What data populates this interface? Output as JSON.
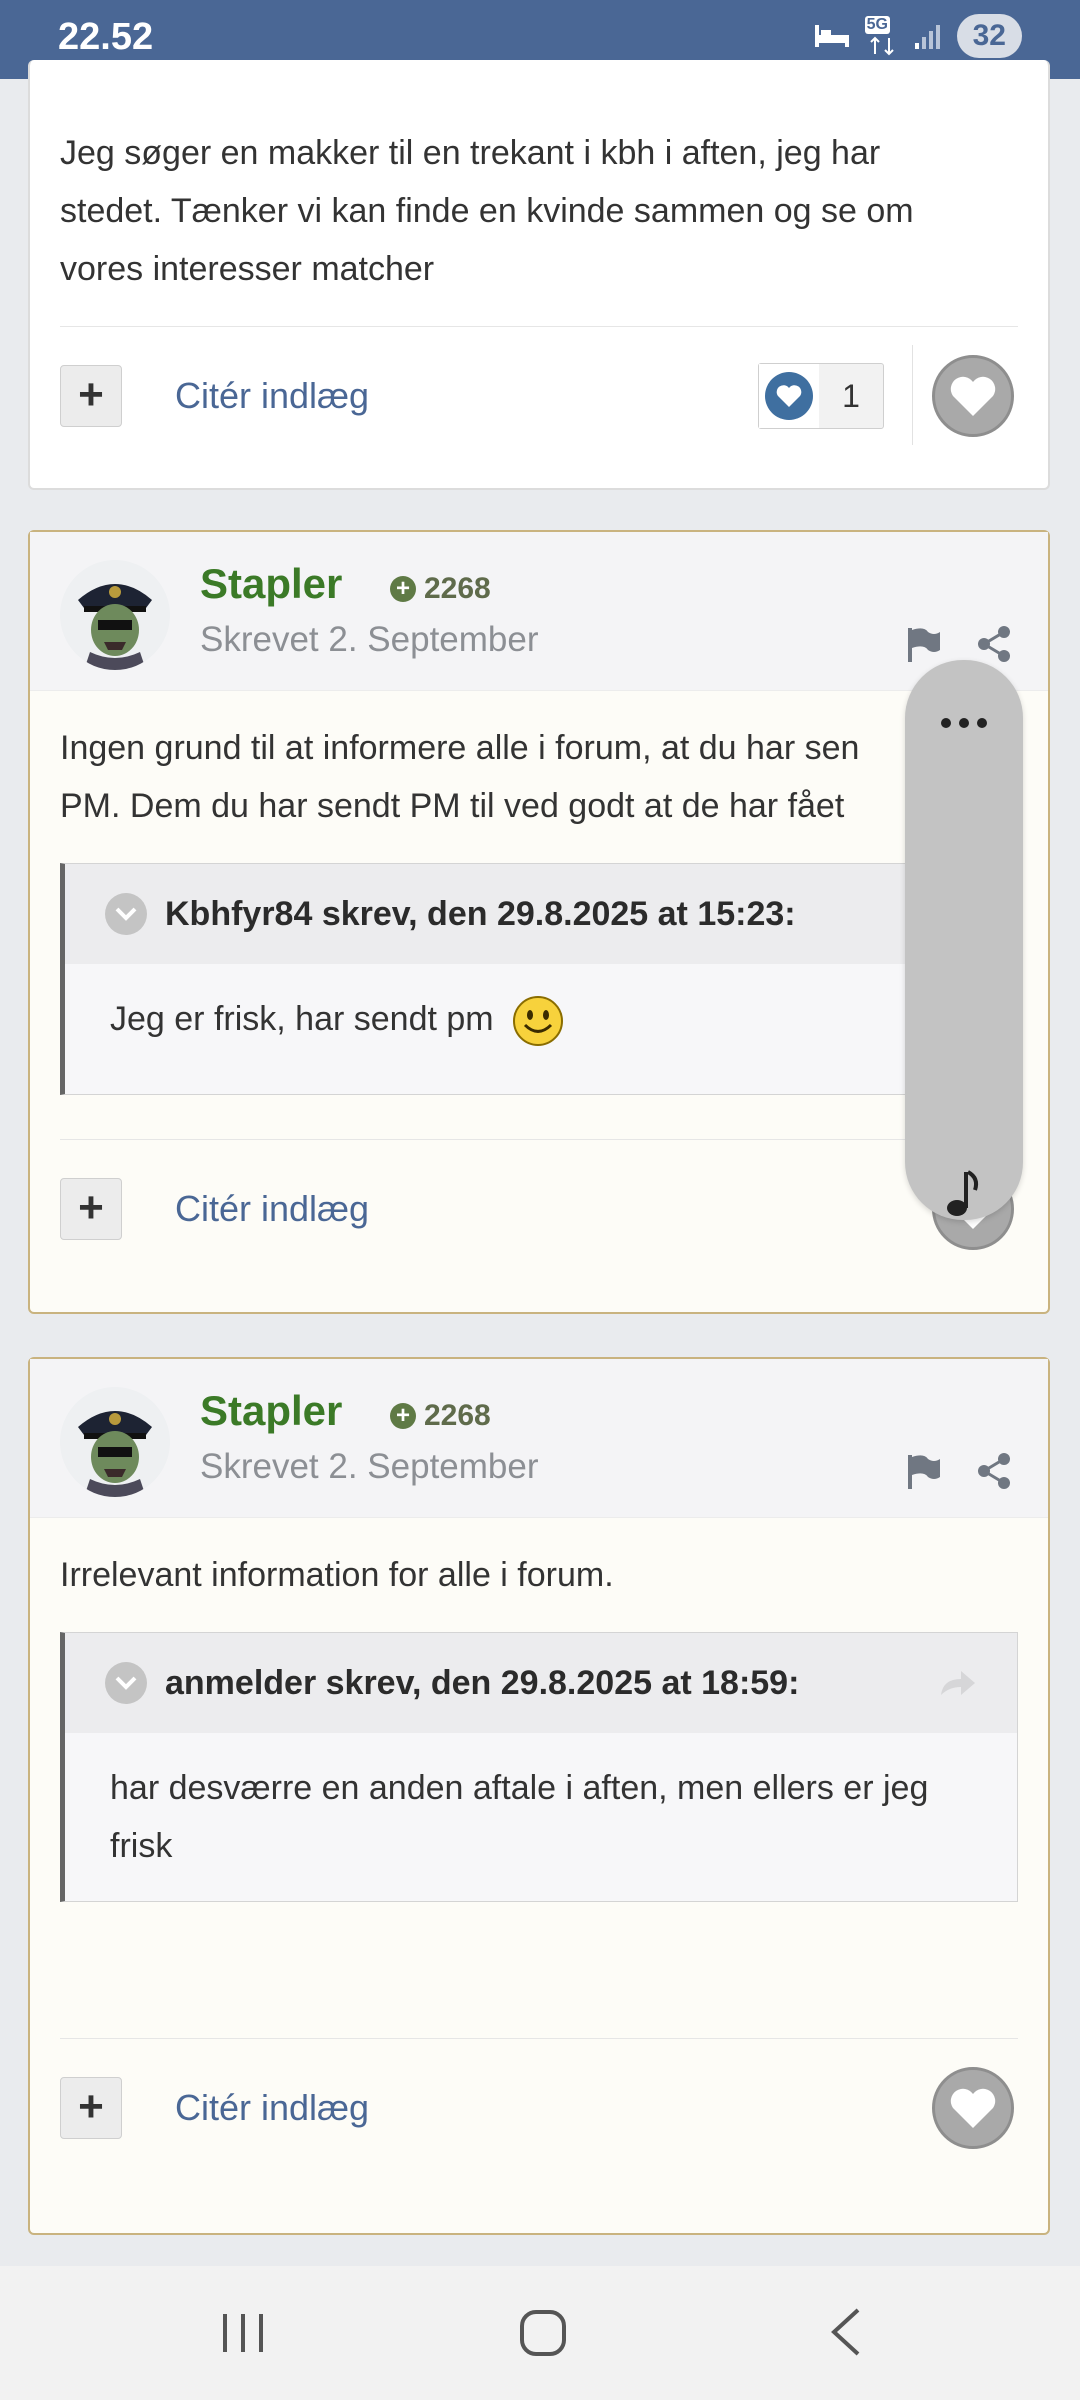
{
  "status_bar": {
    "time": "22.52",
    "network": "5G",
    "battery": "32"
  },
  "post1": {
    "body": [
      "Jeg søger en makker til en trekant i kbh i aften, jeg har",
      "stedet. Tænker vi kan finde en kvinde sammen og se om",
      "vores interesser matcher"
    ],
    "quote_label": "Citér indlæg",
    "like_count": "1"
  },
  "post2": {
    "author": "Stapler",
    "reputation": "2268",
    "date": "Skrevet 2. September",
    "body": [
      "Ingen grund til at informere alle i forum, at du har sen",
      "PM. Dem du har sendt PM til ved godt at de har fået"
    ],
    "quote": {
      "header": "Kbhfyr84 skrev, den 29.8.2025 at 15:23:",
      "text": "Jeg er frisk, har sendt pm"
    },
    "quote_label": "Citér indlæg"
  },
  "post3": {
    "author": "Stapler",
    "reputation": "2268",
    "date": "Skrevet 2. September",
    "body": "Irrelevant information for alle i forum.",
    "quote": {
      "header": "anmelder skrev, den 29.8.2025 at 18:59:",
      "text": [
        "har desværre en anden aftale i aften, men ellers er jeg",
        "frisk"
      ]
    },
    "quote_label": "Citér indlæg"
  },
  "icons": {
    "flag": "flag-icon",
    "share": "share-icon",
    "heart": "heart-icon",
    "more": "more-icon",
    "music": "music-note-icon"
  },
  "colors": {
    "status_bar": "#4a6795",
    "author": "#3b7a27",
    "link": "#4a6795",
    "highlight_border": "#c9b37f"
  }
}
